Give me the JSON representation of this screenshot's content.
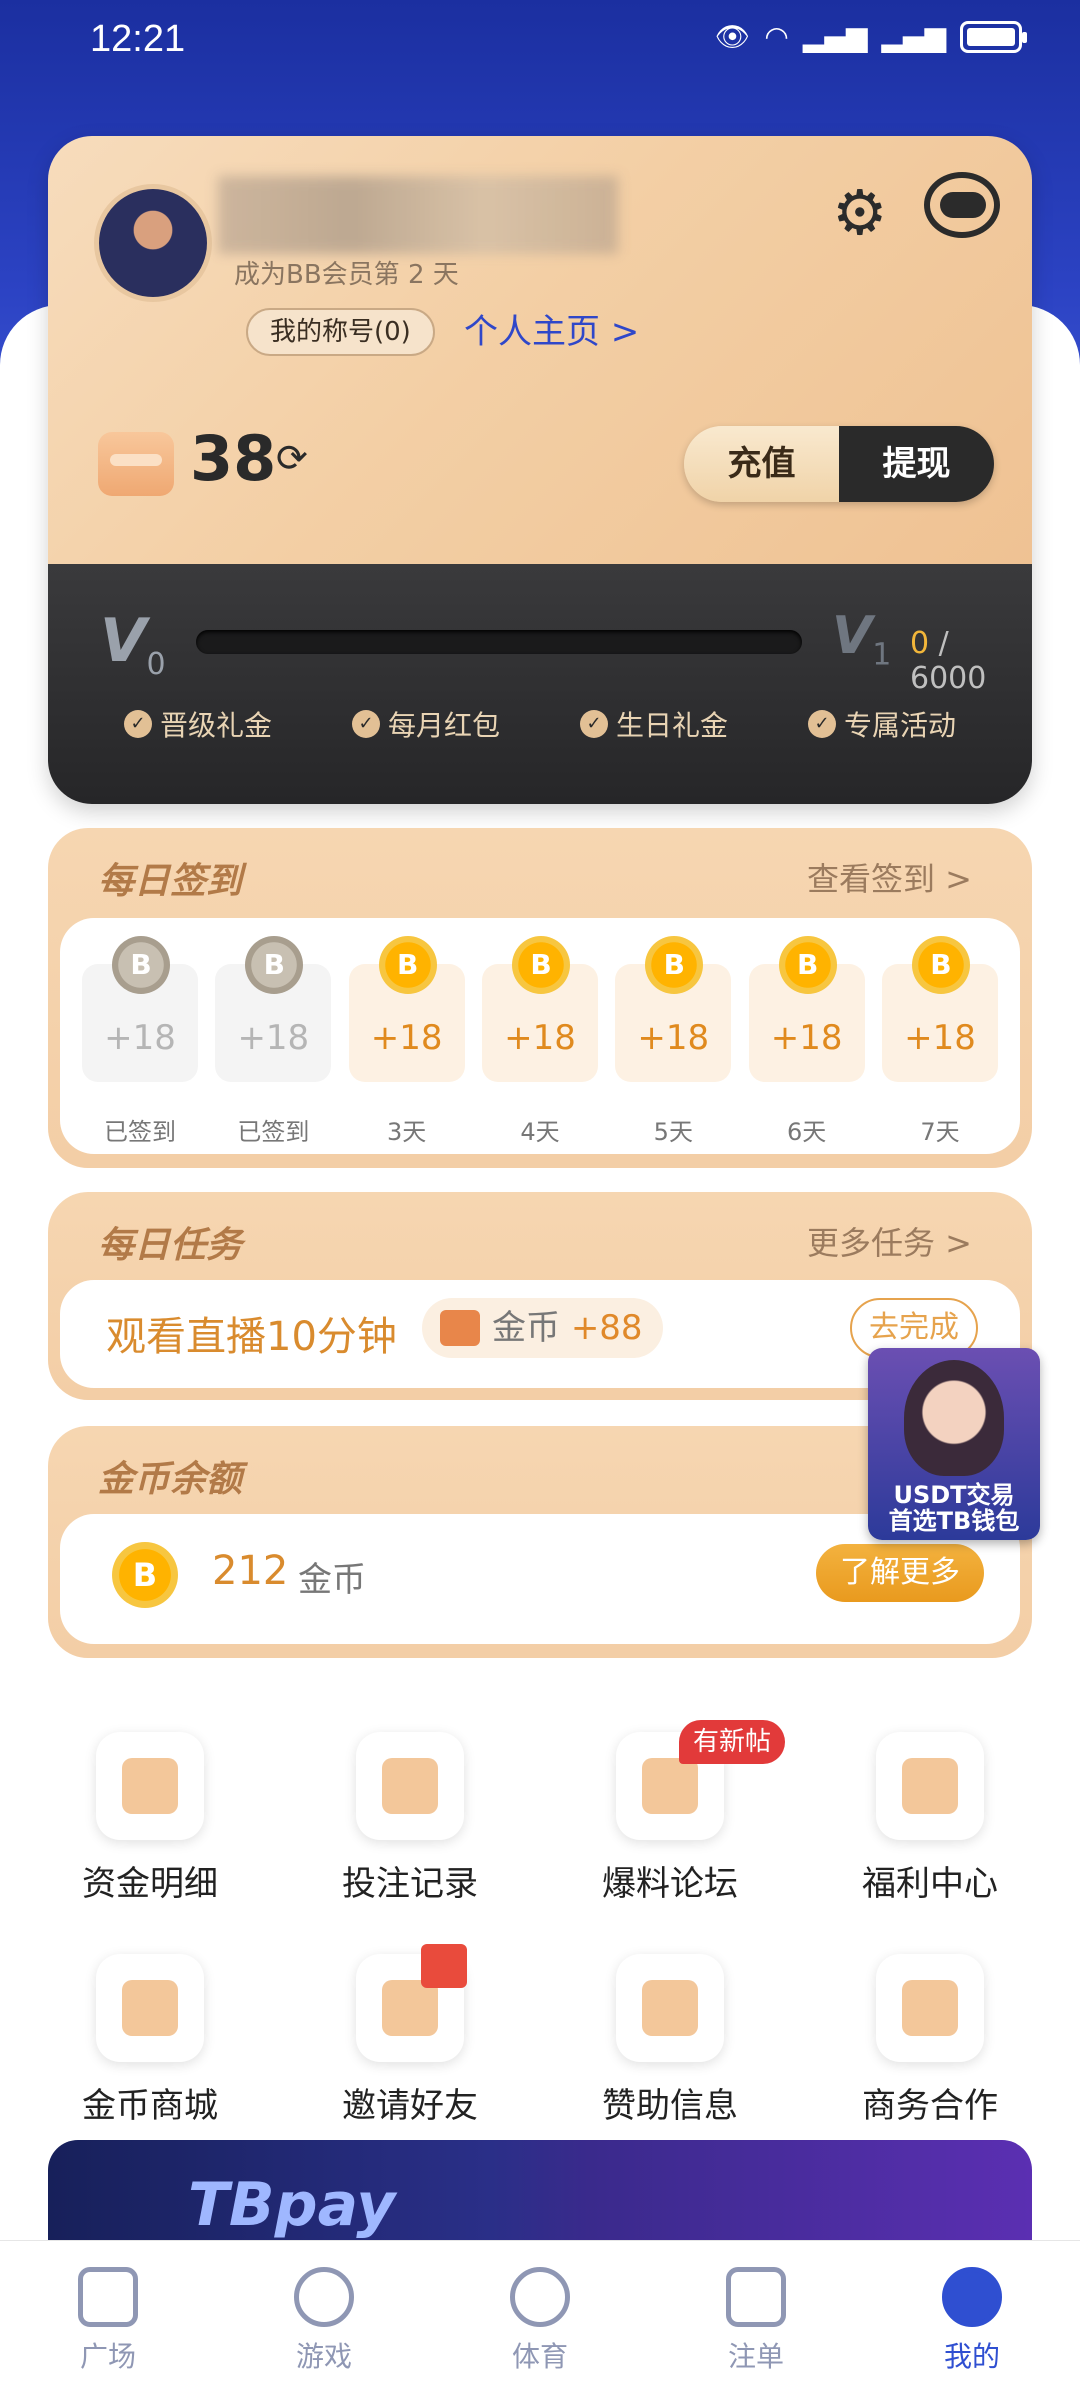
{
  "status": {
    "time": "12:21"
  },
  "profile": {
    "subtitle": "成为BB会员第 2 天",
    "title_badge": "我的称号(0)",
    "home_link": "个人主页 >",
    "balance": "38",
    "recharge": "充值",
    "withdraw": "提现"
  },
  "vip": {
    "current": "0",
    "next": "1",
    "progress_value": "0",
    "progress_target": "/ 6000",
    "perks": [
      "晋级礼金",
      "每月红包",
      "生日礼金",
      "专属活动"
    ]
  },
  "signin": {
    "title": "每日签到",
    "link": "查看签到 >",
    "days": [
      {
        "amount": "+18",
        "label": "已签到",
        "done": true
      },
      {
        "amount": "+18",
        "label": "已签到",
        "done": true
      },
      {
        "amount": "+18",
        "label": "3天",
        "done": false
      },
      {
        "amount": "+18",
        "label": "4天",
        "done": false
      },
      {
        "amount": "+18",
        "label": "5天",
        "done": false
      },
      {
        "amount": "+18",
        "label": "6天",
        "done": false
      },
      {
        "amount": "+18",
        "label": "7天",
        "done": false
      }
    ],
    "coin_letter": "B"
  },
  "tasks": {
    "title": "每日任务",
    "link": "更多任务 >",
    "task": "观看直播10分钟",
    "reward_label": "金币",
    "reward_value": "+88",
    "go": "去完成"
  },
  "promo": {
    "line1": "USDT交易",
    "line2": "首选TB钱包"
  },
  "gold": {
    "title": "金币余额",
    "amount": "212",
    "unit": "金币",
    "more": "了解更多"
  },
  "grid1": [
    {
      "label": "资金明细"
    },
    {
      "label": "投注记录"
    },
    {
      "label": "爆料论坛",
      "tag": "有新帖"
    },
    {
      "label": "福利中心"
    }
  ],
  "grid2": [
    {
      "label": "金币商城"
    },
    {
      "label": "邀请好友"
    },
    {
      "label": "赞助信息"
    },
    {
      "label": "商务合作"
    }
  ],
  "banner": {
    "text": "TBpay"
  },
  "nav": [
    {
      "label": "广场"
    },
    {
      "label": "游戏"
    },
    {
      "label": "体育"
    },
    {
      "label": "注单"
    },
    {
      "label": "我的",
      "active": true
    }
  ]
}
